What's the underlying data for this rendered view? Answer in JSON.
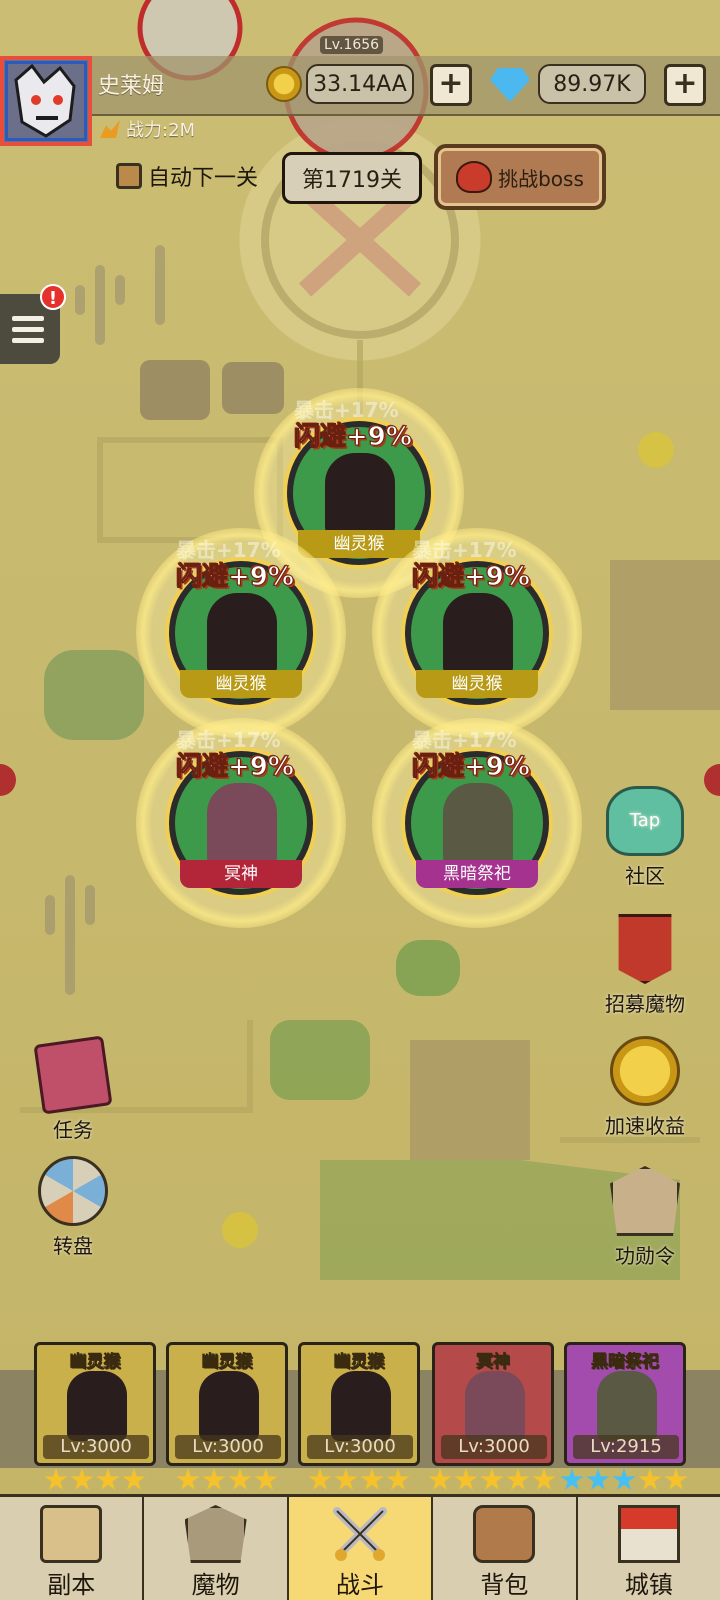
{
  "player": {
    "name": "史莱姆",
    "power": "战力:2M",
    "gold": "33.14AA",
    "gems": "89.97K"
  },
  "enemy": {
    "level": "Lv.1656"
  },
  "stage": {
    "auto_next_label": "自动下一关",
    "current_level": "第1719关",
    "challenge_boss_label": "挑战boss"
  },
  "menu": {
    "notice_badge": "!"
  },
  "formation": [
    {
      "name": "幽灵猴",
      "buff": "闪避+9%",
      "crit": "暴击+17%",
      "name_color": "#b89a17",
      "body_color": "#2a1d1d"
    },
    {
      "name": "幽灵猴",
      "buff": "闪避+9%",
      "crit": "暴击+17%",
      "name_color": "#b89a17",
      "body_color": "#2a1d1d"
    },
    {
      "name": "幽灵猴",
      "buff": "闪避+9%",
      "crit": "暴击+17%",
      "name_color": "#b89a17",
      "body_color": "#2a1d1d"
    },
    {
      "name": "冥神",
      "buff": "闪避+9%",
      "crit": "暴击+17%",
      "name_color": "#b3263a",
      "body_color": "#7a4a5a"
    },
    {
      "name": "黑暗祭祀",
      "buff": "闪避+9%",
      "crit": "暴击+17%",
      "name_color": "#a4328e",
      "body_color": "#5a5a44"
    }
  ],
  "side_menu": {
    "community": "社区",
    "community_tap": "Tap",
    "recruit": "招募魔物",
    "speedup": "加速收益",
    "merit": "功勋令",
    "tasks": "任务",
    "wheel": "转盘"
  },
  "team": [
    {
      "name": "幽灵猴",
      "level": "Lv:3000",
      "bg": "#c9b04a",
      "gold_stars": 5,
      "blue_stars": 0
    },
    {
      "name": "幽灵猴",
      "level": "Lv:3000",
      "bg": "#c9b04a",
      "gold_stars": 5,
      "blue_stars": 0
    },
    {
      "name": "幽灵猴",
      "level": "Lv:3000",
      "bg": "#c9b04a",
      "gold_stars": 5,
      "blue_stars": 0
    },
    {
      "name": "冥神",
      "level": "Lv:3000",
      "bg": "#b44a4a",
      "gold_stars": 6,
      "blue_stars": 0
    },
    {
      "name": "黑暗祭祀",
      "level": "Lv:2915",
      "bg": "#a44bae",
      "gold_stars": 2,
      "blue_stars": 4
    }
  ],
  "nav": {
    "dungeon": "副本",
    "monsters": "魔物",
    "battle": "战斗",
    "backpack": "背包",
    "town": "城镇"
  },
  "colors": {
    "accent": "#f6d974",
    "danger": "#e74e3c",
    "gem": "#4bb8f0"
  }
}
